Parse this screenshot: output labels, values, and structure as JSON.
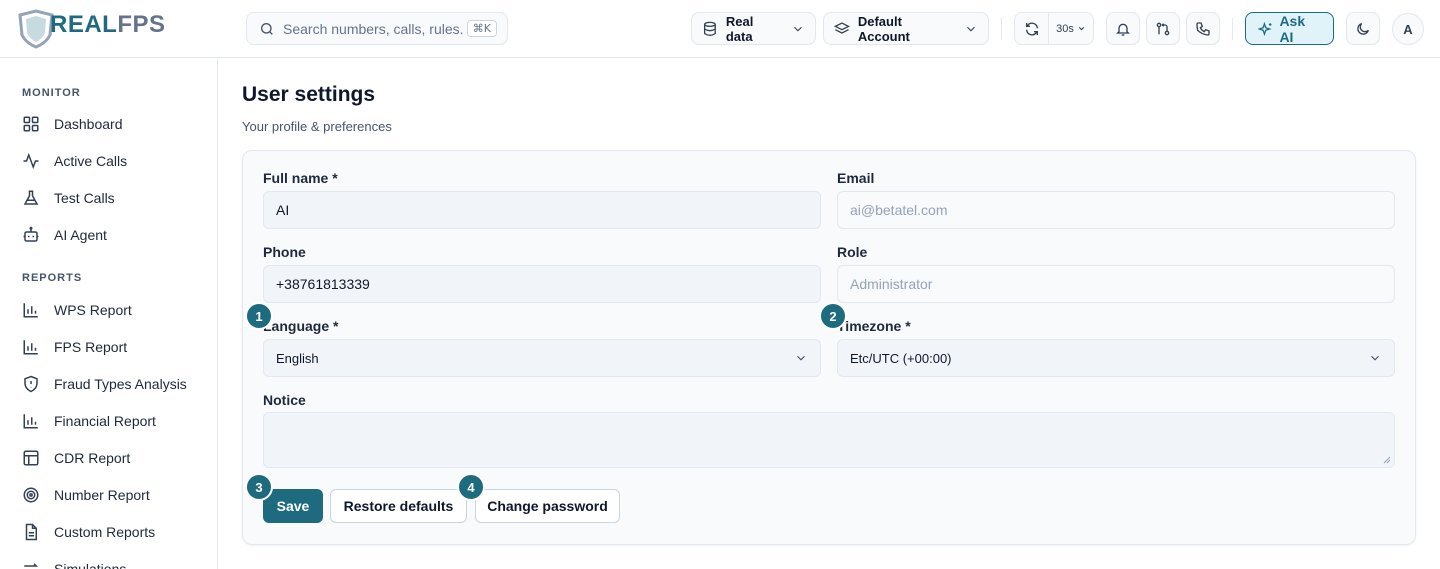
{
  "brand": {
    "real": "REAL",
    "fps": "FPS"
  },
  "search": {
    "placeholder": "Search numbers, calls, rules...",
    "shortcut": "⌘K"
  },
  "header": {
    "data_source": "Real data",
    "account": "Default Account",
    "refresh_interval": "30s",
    "ask_ai": "Ask AI",
    "avatar_initial": "A"
  },
  "sidebar": {
    "monitor_title": "MONITOR",
    "monitor_items": [
      {
        "label": "Dashboard",
        "icon": "grid-icon"
      },
      {
        "label": "Active Calls",
        "icon": "activity-icon"
      },
      {
        "label": "Test Calls",
        "icon": "flask-icon"
      },
      {
        "label": "AI Agent",
        "icon": "bot-icon"
      }
    ],
    "reports_title": "REPORTS",
    "reports_items": [
      {
        "label": "WPS Report",
        "icon": "bar-chart-icon"
      },
      {
        "label": "FPS Report",
        "icon": "bar-chart-icon"
      },
      {
        "label": "Fraud Types Analysis",
        "icon": "shield-alert-icon"
      },
      {
        "label": "Financial Report",
        "icon": "bar-chart-icon"
      },
      {
        "label": "CDR Report",
        "icon": "table-icon"
      },
      {
        "label": "Number Report",
        "icon": "target-icon"
      },
      {
        "label": "Custom Reports",
        "icon": "file-text-icon"
      },
      {
        "label": "Simulations",
        "icon": "arrows-icon"
      }
    ]
  },
  "page": {
    "title": "User settings",
    "subtitle": "Your profile & preferences"
  },
  "form": {
    "full_name": {
      "label": "Full name *",
      "value": "AI"
    },
    "email": {
      "label": "Email",
      "value": "ai@betatel.com"
    },
    "phone": {
      "label": "Phone",
      "value": "+38761813339"
    },
    "role": {
      "label": "Role",
      "value": "Administrator"
    },
    "language": {
      "label": "Language *",
      "value": "English"
    },
    "timezone": {
      "label": "Timezone *",
      "value": "Etc/UTC (+00:00)"
    },
    "notice": {
      "label": "Notice",
      "value": ""
    }
  },
  "actions": {
    "save": "Save",
    "restore": "Restore defaults",
    "change_password": "Change password"
  },
  "markers": [
    "1",
    "2",
    "3",
    "4"
  ],
  "colors": {
    "accent": "#1e6b80",
    "accent_light": "#dff3f8"
  }
}
